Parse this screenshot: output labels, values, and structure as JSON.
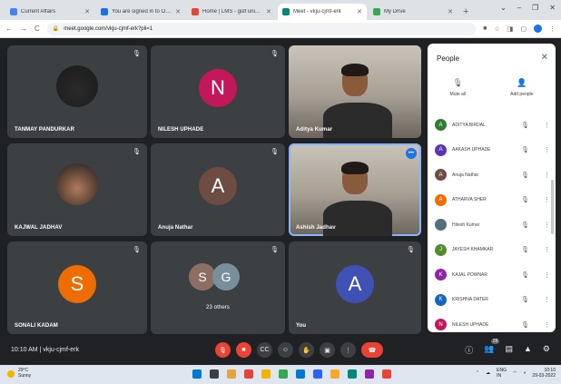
{
  "browser": {
    "tabs": [
      {
        "label": "Current Affairs",
        "color": "#4285f4",
        "active": false
      },
      {
        "label": "You are signed in to Outlook",
        "color": "#1a73e8",
        "active": false
      },
      {
        "label": "Home | LMS - gulf university",
        "color": "#ea4335",
        "active": false
      },
      {
        "label": "Meet - vkju-cjmf-erk",
        "color": "#00897b",
        "active": true
      },
      {
        "label": "My Drive",
        "color": "#34a853",
        "active": false
      }
    ],
    "new_tab": "+",
    "window_controls": [
      "⌄",
      "–",
      "❐",
      "✕"
    ],
    "address": "meet.google.com/vkju-cjmf-erk?pli=1",
    "back": "←",
    "forward": "→",
    "reload": "C"
  },
  "tiles": [
    {
      "name": "TANMAY PANDURKAR",
      "type": "photo",
      "photo_color": "#2a2a2a",
      "mic_off": true
    },
    {
      "name": "NILESH UPHADE",
      "type": "avatar",
      "letter": "N",
      "avatar_color": "#c2185b",
      "mic_off": true
    },
    {
      "name": "Aditya Kumar",
      "type": "video",
      "mic_off": false
    },
    {
      "name": "KAJWAL JADHAV",
      "type": "photo",
      "photo_color": "#b07a5a",
      "mic_off": true
    },
    {
      "name": "Anuja Nathar",
      "type": "avatar",
      "letter": "A",
      "avatar_color": "#6d4c41",
      "mic_off": true
    },
    {
      "name": "Ashish Jadhav",
      "type": "video",
      "mic_off": false,
      "speaking": true
    },
    {
      "name": "SONALI KADAM",
      "type": "avatar",
      "letter": "S",
      "avatar_color": "#ef6c00",
      "mic_off": true
    },
    {
      "name": "23 others",
      "type": "group",
      "letters": [
        "S",
        "G"
      ],
      "colors": [
        "#8d6e63",
        "#78909c"
      ],
      "mic_off": true
    },
    {
      "name": "You",
      "type": "avatar",
      "letter": "A",
      "avatar_color": "#3f51b5",
      "mic_off": true
    }
  ],
  "panel": {
    "title": "People",
    "close": "✕",
    "mute_all": "Mute all",
    "add_people": "Add people",
    "people": [
      {
        "initial": "A",
        "name": "ADITYA BIRDAL",
        "color": "#2e7d32"
      },
      {
        "initial": "A",
        "name": "AAKASH UPHADE",
        "color": "#5e35b1"
      },
      {
        "initial": "A",
        "name": "Anuja Nathar",
        "color": "#6d4c41"
      },
      {
        "initial": "A",
        "name": "ATHARVA SHER",
        "color": "#ef6c00"
      },
      {
        "initial": "",
        "name": "Hitesh Kumar",
        "color": "#546e7a"
      },
      {
        "initial": "J",
        "name": "JAYESH KHAMKAR",
        "color": "#558b2f"
      },
      {
        "initial": "K",
        "name": "KAJAL POWNAR",
        "color": "#8e24aa"
      },
      {
        "initial": "K",
        "name": "KRISHNA DATER",
        "color": "#1565c0"
      },
      {
        "initial": "N",
        "name": "NILESH UPHADE",
        "color": "#c2185b"
      }
    ]
  },
  "controls": {
    "time": "10:10 AM",
    "separator": "|",
    "code": "vkju-cjmf-erk",
    "mic_icon": "🎙",
    "cc_icon": "CC",
    "emoji_icon": "☺",
    "hand_icon": "✋",
    "present_icon": "▣",
    "more_icon": "⋮",
    "hangup_icon": "☎",
    "info_icon": "ⓘ",
    "people_icon": "👥",
    "people_count": "26",
    "chat_icon": "▤",
    "activities_icon": "▲",
    "host_icon": "⚙"
  },
  "taskbar": {
    "temperature": "29°C",
    "weather_text": "Sunny",
    "icon_colors": [
      "#0078d4",
      "#3c4043",
      "#e8a33a",
      "#ea4335",
      "#f4b400",
      "#34a853",
      "#0078d4",
      "#2962ff",
      "#f9a825",
      "#00897b",
      "#8e24aa",
      "#ea4335"
    ],
    "tray_lang": "ENG",
    "tray_region": "IN",
    "clock_time": "10:10",
    "clock_date": "29-03-2022"
  }
}
